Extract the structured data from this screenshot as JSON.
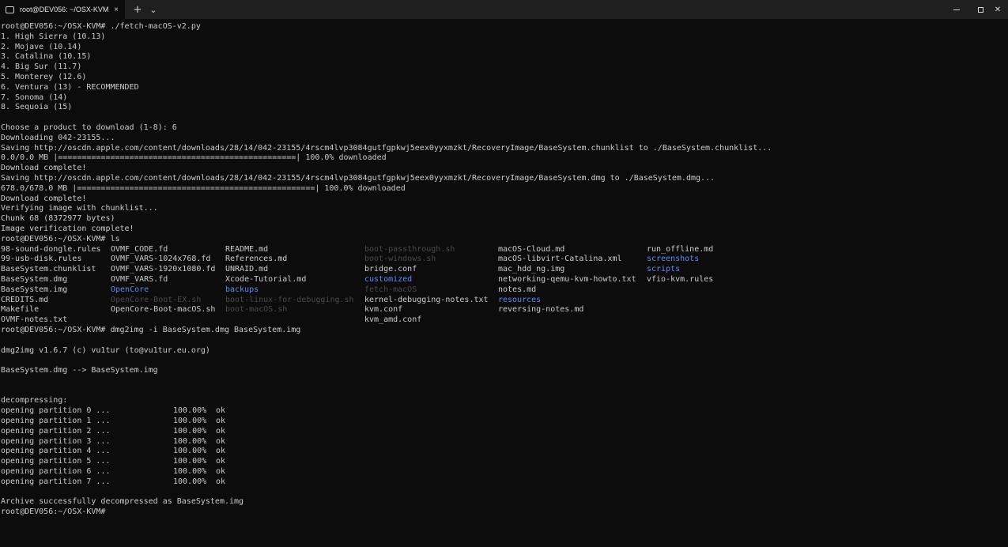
{
  "window": {
    "tab_title": "root@DEV056: ~/OSX-KVM",
    "tab_close": "×",
    "new_tab": "+",
    "dropdown": "⌄",
    "minimize": "",
    "maximize": "",
    "close": "✕"
  },
  "colors": {
    "background": "#0c0c0c",
    "text": "#cccccc",
    "directory": "#5e8cf0",
    "titlebar": "#1f1f1f"
  },
  "console": {
    "block1": [
      "root@DEV056:~/OSX-KVM# ./fetch-macOS-v2.py",
      "1. High Sierra (10.13)",
      "2. Mojave (10.14)",
      "3. Catalina (10.15)",
      "4. Big Sur (11.7)",
      "5. Monterey (12.6)",
      "6. Ventura (13) - RECOMMENDED",
      "7. Sonoma (14)",
      "8. Sequoia (15)",
      "",
      "Choose a product to download (1-8): 6",
      "Downloading 042-23155...",
      "Saving http://oscdn.apple.com/content/downloads/28/14/042-23155/4rscm4lvp3084gutfgpkwj5eex0yyxmzkt/RecoveryImage/BaseSystem.chunklist to ./BaseSystem.chunklist...",
      "0.0/0.0 MB |==================================================| 100.0% downloaded",
      "Download complete!",
      "Saving http://oscdn.apple.com/content/downloads/28/14/042-23155/4rscm4lvp3084gutfgpkwj5eex0yyxmzkt/RecoveryImage/BaseSystem.dmg to ./BaseSystem.dmg...",
      "678.0/678.0 MB |==================================================| 100.0% downloaded",
      "Download complete!",
      "Verifying image with chunklist...",
      "Chunk 68 (8372977 bytes)",
      "Image verification complete!",
      "root@DEV056:~/OSX-KVM# ls"
    ],
    "ls_rows": [
      [
        "98-sound-dongle.rules",
        "OVMF_CODE.fd",
        "README.md",
        "boot-passthrough.sh",
        "macOS-Cloud.md",
        "run_offline.md"
      ],
      [
        "99-usb-disk.rules",
        "OVMF_VARS-1024x768.fd",
        "References.md",
        "boot-windows.sh",
        "macOS-libvirt-Catalina.xml",
        "screenshots"
      ],
      [
        "BaseSystem.chunklist",
        "OVMF_VARS-1920x1080.fd",
        "UNRAID.md",
        "bridge.conf",
        "mac_hdd_ng.img",
        "scripts"
      ],
      [
        "BaseSystem.dmg",
        "OVMF_VARS.fd",
        "Xcode-Tutorial.md",
        "customized",
        "networking-qemu-kvm-howto.txt",
        "vfio-kvm.rules"
      ],
      [
        "BaseSystem.img",
        "OpenCore",
        "backups",
        "fetch-macOS",
        "notes.md",
        ""
      ],
      [
        "CREDITS.md",
        "OpenCore-Boot-EX.sh",
        "boot-linux-for-debugging.sh",
        "kernel-debugging-notes.txt",
        "resources",
        ""
      ],
      [
        "Makefile",
        "OpenCore-Boot-macOS.sh",
        "boot-macOS.sh",
        "kvm.conf",
        "reversing-notes.md",
        ""
      ],
      [
        "OVMF-notes.txt",
        "",
        "",
        "kvm_amd.conf",
        "",
        ""
      ]
    ],
    "ls_styles": [
      [
        "",
        "",
        "",
        "faint",
        "",
        ""
      ],
      [
        "",
        "",
        "",
        "faint",
        "",
        "dir"
      ],
      [
        "",
        "",
        "",
        "",
        "",
        "dir"
      ],
      [
        "",
        "",
        "",
        "dir",
        "",
        ""
      ],
      [
        "",
        "dir",
        "dir",
        "faint",
        "",
        ""
      ],
      [
        "",
        "faint",
        "faint",
        "",
        "dir",
        ""
      ],
      [
        "",
        "",
        "faint",
        "",
        "",
        ""
      ],
      [
        "",
        "",
        "",
        "",
        "",
        ""
      ]
    ],
    "block2": [
      "root@DEV056:~/OSX-KVM# dmg2img -i BaseSystem.dmg BaseSystem.img",
      "",
      "dmg2img v1.6.7 (c) vu1tur (to@vu1tur.eu.org)",
      "",
      "BaseSystem.dmg --> BaseSystem.img",
      "",
      "",
      "decompressing:"
    ],
    "partitions": [
      [
        "opening partition 0 ...",
        "100.00%",
        "ok"
      ],
      [
        "opening partition 1 ...",
        "100.00%",
        "ok"
      ],
      [
        "opening partition 2 ...",
        "100.00%",
        "ok"
      ],
      [
        "opening partition 3 ...",
        "100.00%",
        "ok"
      ],
      [
        "opening partition 4 ...",
        "100.00%",
        "ok"
      ],
      [
        "opening partition 5 ...",
        "100.00%",
        "ok"
      ],
      [
        "opening partition 6 ...",
        "100.00%",
        "ok"
      ],
      [
        "opening partition 7 ...",
        "100.00%",
        "ok"
      ]
    ],
    "block3": [
      "",
      "Archive successfully decompressed as BaseSystem.img",
      "root@DEV056:~/OSX-KVM#"
    ]
  }
}
